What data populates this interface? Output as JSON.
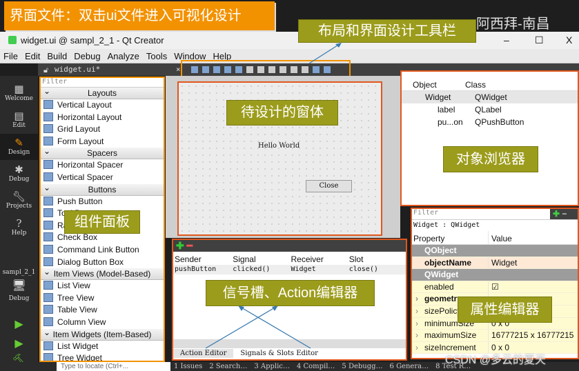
{
  "annotations": {
    "banner": "界面文件：双击ui文件进入可视化设计",
    "toolbar": "布局和界面设计工具栏",
    "form": "待设计的窗体",
    "widget_box": "组件面板",
    "object_inspector": "对象浏览器",
    "signal_slot": "信号槽、Action编辑器",
    "property_editor": "属性编辑器",
    "watermark_top": "阿西拜-南昌",
    "watermark_bottom": "CSDN @多云的夏天"
  },
  "colors": {
    "banner": "#f39200",
    "callout": "#9c9c1c",
    "highlight_box": "#e0571d",
    "widget_box_border": "#f39200"
  },
  "window": {
    "title": "widget.ui @ sampl_2_1 - Qt Creator",
    "minimize": "–",
    "maximize": "☐",
    "close": "X"
  },
  "menu": [
    "File",
    "Edit",
    "Build",
    "Debug",
    "Analyze",
    "Tools",
    "Window",
    "Help"
  ],
  "editor_tab": {
    "file": "widget.ui*",
    "close": "×"
  },
  "sidebar": [
    {
      "label": "Welcome",
      "icon": "grid-icon"
    },
    {
      "label": "Edit",
      "icon": "document-icon"
    },
    {
      "label": "Design",
      "icon": "pencil-icon",
      "active": true
    },
    {
      "label": "Debug",
      "icon": "bug-icon"
    },
    {
      "label": "Projects",
      "icon": "wrench-icon"
    },
    {
      "label": "Help",
      "icon": "help-icon"
    }
  ],
  "kit": {
    "project": "sampl_2_1",
    "mode": "Debug"
  },
  "widget_box": {
    "filter_placeholder": "Filter",
    "sections": [
      {
        "title": "Layouts",
        "items": [
          "Vertical Layout",
          "Horizontal Layout",
          "Grid Layout",
          "Form Layout"
        ]
      },
      {
        "title": "Spacers",
        "items": [
          "Horizontal Spacer",
          "Vertical Spacer"
        ]
      },
      {
        "title": "Buttons",
        "items": [
          "Push Button",
          "Tool Button",
          "Radio Button",
          "Check Box",
          "Command Link Button",
          "Dialog Button Box"
        ]
      },
      {
        "title": "Item Views (Model-Based)",
        "items": [
          "List View",
          "Tree View",
          "Table View",
          "Column View"
        ]
      },
      {
        "title": "Item Widgets (Item-Based)",
        "items": [
          "List Widget",
          "Tree Widget"
        ]
      }
    ]
  },
  "form": {
    "label": "Hello World",
    "button": "Close"
  },
  "object_inspector": {
    "headers": [
      "Object",
      "Class"
    ],
    "rows": [
      {
        "object": "Widget",
        "class": "QWidget"
      },
      {
        "object": "label",
        "class": "QLabel"
      },
      {
        "object": "pu...on",
        "class": "QPushButton"
      }
    ]
  },
  "property_editor": {
    "filter_placeholder": "Filter",
    "context": "Widget : QWidget",
    "headers": [
      "Property",
      "Value"
    ],
    "rows": [
      {
        "group": "QObject"
      },
      {
        "name": "objectName",
        "value": "Widget",
        "bold": true
      },
      {
        "group": "QWidget"
      },
      {
        "name": "enabled",
        "value": "☑"
      },
      {
        "name": "geometry",
        "value": "",
        "bold": true,
        "expand": true
      },
      {
        "name": "sizePolicy",
        "value": "[Preferred...",
        "expand": true
      },
      {
        "name": "minimumSize",
        "value": "0 x 0",
        "expand": true
      },
      {
        "name": "maximumSize",
        "value": "16777215 x 16777215",
        "expand": true
      },
      {
        "name": "sizeIncrement",
        "value": "0 x 0",
        "expand": true
      }
    ]
  },
  "signal_slot": {
    "headers": [
      "Sender",
      "Signal",
      "Receiver",
      "Slot"
    ],
    "rows": [
      [
        "pushButton",
        "clicked()",
        "Widget",
        "close()"
      ]
    ],
    "tabs": [
      "Action Editor",
      "Signals & Slots Editor"
    ]
  },
  "status_bar": {
    "locator_placeholder": "Type to locate (Ctrl+...",
    "panes": [
      "1 Issues",
      "2 Search…",
      "3 Applic…",
      "4 Compil…",
      "5 Debugg…",
      "6 Genera…",
      "8 Test R…"
    ]
  }
}
